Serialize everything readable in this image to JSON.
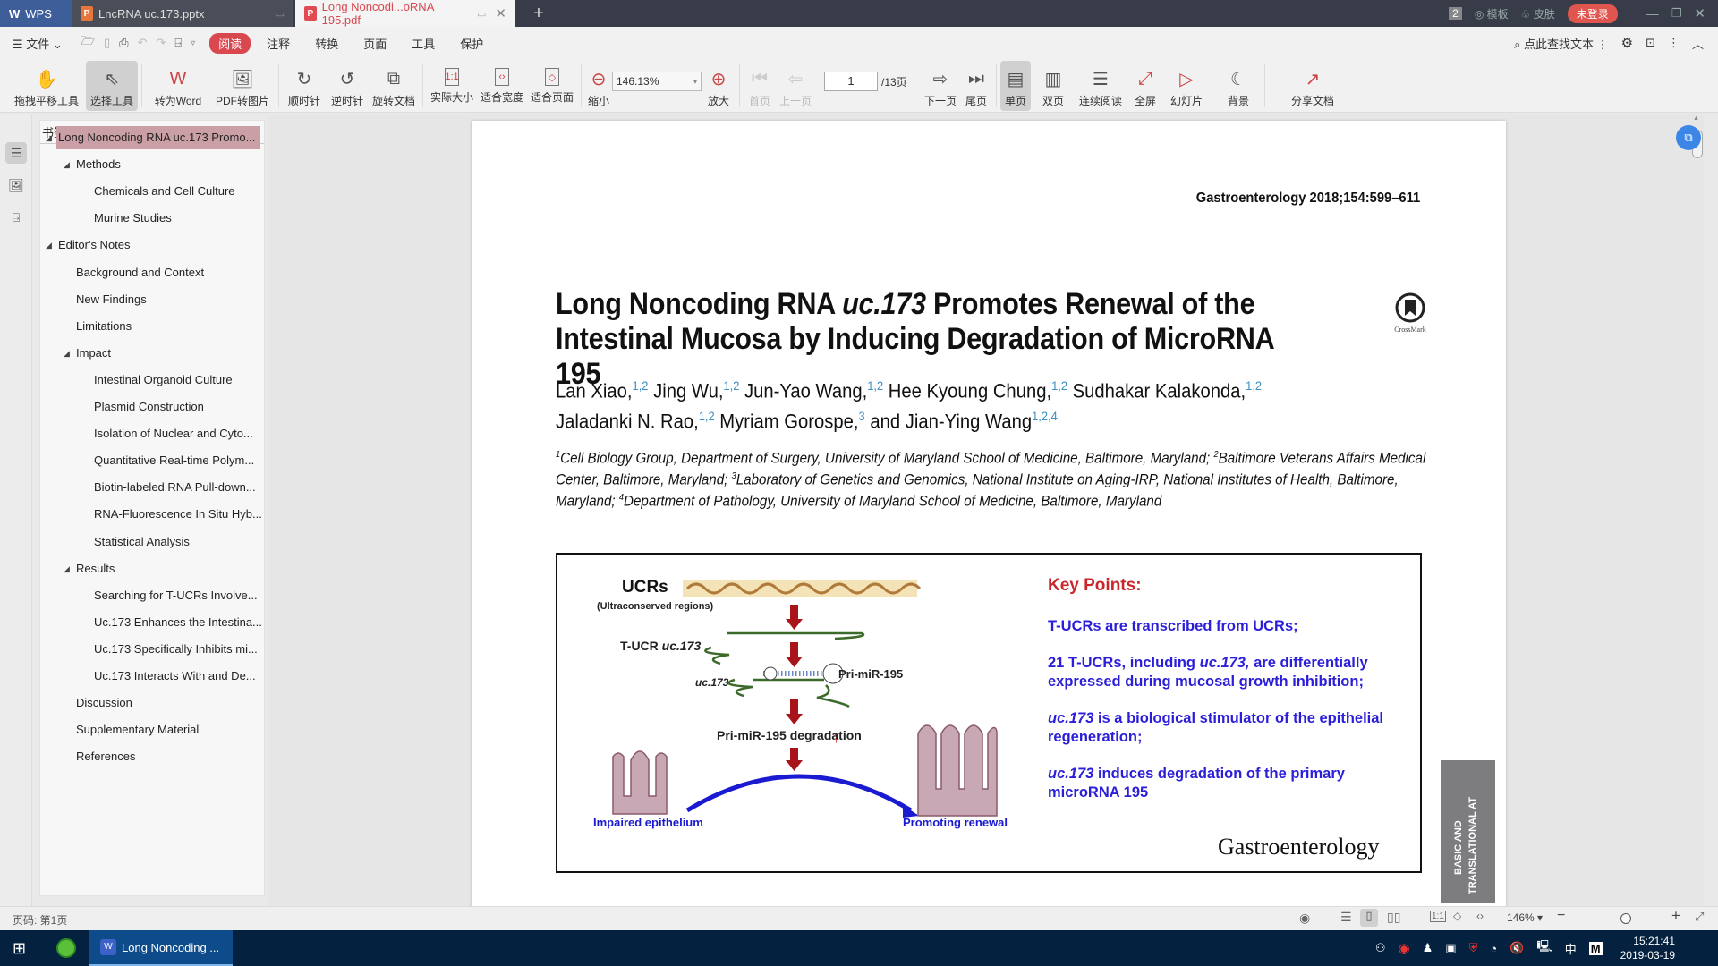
{
  "titlebar": {
    "app_name": "WPS",
    "tabs": [
      {
        "label": "LncRNA uc.173.pptx",
        "type": "pptx",
        "active": false
      },
      {
        "label": "Long Noncodi...oRNA 195.pdf",
        "type": "pdf",
        "active": true
      }
    ],
    "window_count": "2",
    "template_label": "模板",
    "skin_label": "皮肤",
    "login_label": "未登录"
  },
  "menubar": {
    "file_label": "文件",
    "read_label": "阅读",
    "items": [
      "注释",
      "转换",
      "页面",
      "工具",
      "保护"
    ],
    "search_label": "点此查找文本"
  },
  "toolbar": {
    "tools": [
      {
        "label": "拖拽平移工具",
        "icon": "hand-icon"
      },
      {
        "label": "选择工具",
        "icon": "cursor-icon",
        "active": true
      },
      {
        "label": "转为Word",
        "icon": "convert-word-icon"
      },
      {
        "label": "PDF转图片",
        "icon": "pdf-to-image-icon"
      },
      {
        "label": "顺时针",
        "icon": "rotate-cw-icon"
      },
      {
        "label": "逆时针",
        "icon": "rotate-ccw-icon"
      },
      {
        "label": "旋转文档",
        "icon": "rotate-doc-icon"
      },
      {
        "label": "实际大小",
        "icon": "actual-size-icon"
      },
      {
        "label": "适合宽度",
        "icon": "fit-width-icon"
      },
      {
        "label": "适合页面",
        "icon": "fit-page-icon"
      }
    ],
    "zoom_out_label": "缩小",
    "zoom_value": "146.13%",
    "zoom_in_label": "放大",
    "first_page_label": "首页",
    "prev_page_label": "上一页",
    "current_page": "1",
    "total_pages": "/13页",
    "next_page_label": "下一页",
    "last_page_label": "尾页",
    "single_page_label": "单页",
    "double_page_label": "双页",
    "continuous_label": "连续阅读",
    "fullscreen_label": "全屏",
    "slideshow_label": "幻灯片",
    "background_label": "背景",
    "share_label": "分享文档"
  },
  "bookmarks": {
    "title": "书签",
    "items": [
      {
        "label": "Long Noncoding RNA uc.173 Promo...",
        "level": 0,
        "expanded": true,
        "selected": true
      },
      {
        "label": "Methods",
        "level": 1,
        "expanded": true
      },
      {
        "label": "Chemicals and Cell Culture",
        "level": 2
      },
      {
        "label": "Murine Studies",
        "level": 2
      },
      {
        "label": "Editor's Notes",
        "level": 0,
        "expanded": true
      },
      {
        "label": "Background and Context",
        "level": 1
      },
      {
        "label": "New Findings",
        "level": 1
      },
      {
        "label": "Limitations",
        "level": 1
      },
      {
        "label": "Impact",
        "level": 1,
        "expanded": true
      },
      {
        "label": "Intestinal Organoid Culture",
        "level": 2
      },
      {
        "label": "Plasmid Construction",
        "level": 2
      },
      {
        "label": "Isolation of Nuclear and Cyto...",
        "level": 2
      },
      {
        "label": "Quantitative Real-time Polym...",
        "level": 2
      },
      {
        "label": "Biotin-labeled RNA Pull-down...",
        "level": 2
      },
      {
        "label": "RNA-Fluorescence In Situ Hyb...",
        "level": 2
      },
      {
        "label": "Statistical Analysis",
        "level": 2
      },
      {
        "label": "Results",
        "level": 1,
        "expanded": true
      },
      {
        "label": "Searching for T-UCRs Involve...",
        "level": 2
      },
      {
        "label": "Uc.173 Enhances the Intestina...",
        "level": 2
      },
      {
        "label": "Uc.173 Specifically Inhibits mi...",
        "level": 2
      },
      {
        "label": "Uc.173 Interacts With and De...",
        "level": 2
      },
      {
        "label": "Discussion",
        "level": 1
      },
      {
        "label": "Supplementary Material",
        "level": 1
      },
      {
        "label": "References",
        "level": 1
      }
    ]
  },
  "document": {
    "journal_ref": "Gastroenterology 2018;154:599–611",
    "title_part1": "Long Noncoding RNA ",
    "title_italic": "uc.173",
    "title_part2": " Promotes Renewal of the Intestinal Mucosa by Inducing Degradation of MicroRNA 195",
    "crossmark_label": "CrossMark",
    "authors": [
      {
        "name": "Lan Xiao,",
        "sup": "1,2"
      },
      {
        "name": "Jing Wu,",
        "sup": "1,2"
      },
      {
        "name": "Jun-Yao Wang,",
        "sup": "1,2"
      },
      {
        "name": "Hee Kyoung Chung,",
        "sup": "1,2"
      },
      {
        "name": "Sudhakar Kalakonda,",
        "sup": "1,2"
      },
      {
        "name": "Jaladanki N. Rao,",
        "sup": "1,2"
      },
      {
        "name": "Myriam Gorospe,",
        "sup": "3"
      },
      {
        "name": "and Jian-Ying Wang",
        "sup": "1,2,4"
      }
    ],
    "affiliations": [
      {
        "sup": "1",
        "text": "Cell Biology Group, Department of Surgery, University of Maryland School of Medicine, Baltimore, Maryland; "
      },
      {
        "sup": "2",
        "text": "Baltimore Veterans Affairs Medical Center, Baltimore, Maryland; "
      },
      {
        "sup": "3",
        "text": "Laboratory of Genetics and Genomics, National Institute on Aging-IRP, National Institutes of Health, Baltimore, Maryland; "
      },
      {
        "sup": "4",
        "text": "Department of Pathology, University of Maryland School of Medicine, Baltimore, Maryland"
      }
    ],
    "figure": {
      "ucrs_label": "UCRs",
      "ucrs_sub": "(Ultraconserved regions)",
      "tucr_label": "T-UCR ",
      "tucr_italic": "uc.173",
      "uc173_label": "uc.173",
      "primir_label": "Pri-miR-195",
      "degradation_label": "Pri-miR-195 degradation",
      "impaired_label": "Impaired epithelium",
      "renewal_label": "Promoting renewal"
    },
    "key_points": {
      "title": "Key Points:",
      "points": [
        {
          "italic": "",
          "text": "T-UCRs are transcribed from UCRs;"
        },
        {
          "pre": "21 T-UCRs, including ",
          "italic": "uc.173,",
          "text": " are differentially expressed during mucosal growth inhibition;"
        },
        {
          "italic": "uc.173",
          "text": " is a biological stimulator of the epithelial regeneration;"
        },
        {
          "italic": "uc.173",
          "text": " induces degradation of the primary microRNA 195"
        }
      ],
      "journal_logo": "Gastroenterology"
    },
    "side_tab_line1": "BASIC AND",
    "side_tab_line2": "TRANSLATIONAL AT"
  },
  "statusbar": {
    "page_label": "页码: 第1页",
    "zoom_value": "146%",
    "zoom_fraction": 0.55
  },
  "taskbar": {
    "app_label": "Long Noncoding ...",
    "ime_label": "中",
    "time": "15:21:41",
    "date": "2019-03-19"
  },
  "colors": {
    "accent_red": "#d8484e",
    "keypoint_blue": "#2b1ed8",
    "keypoint_red": "#c9272b",
    "bookmark_selected": "#caa0a6",
    "taskbar_bg": "#04223f"
  }
}
